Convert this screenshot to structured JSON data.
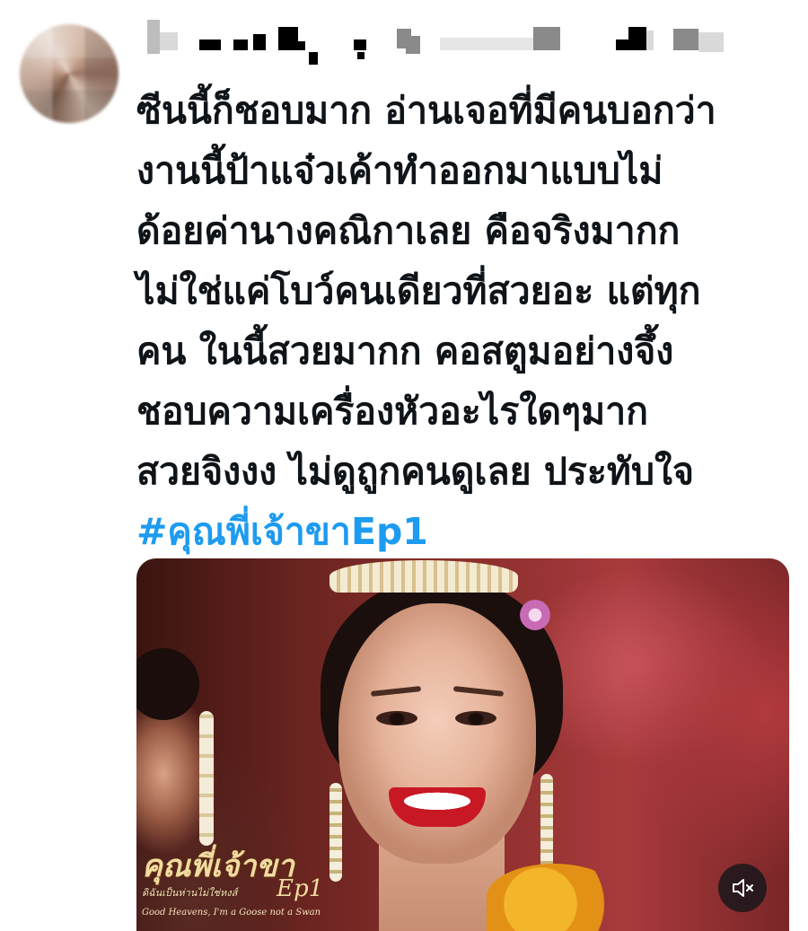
{
  "tweet": {
    "lines": [
      "ซีนนี้ก็ชอบมาก อ่านเจอที่มีคนบอกว่า",
      "งานนี้ป้าแจ๋วเค้าทำออกมาแบบไม่",
      "ด้อยค่านางคณิกาเลย คือจริงมากก",
      "ไม่ใช่แค่โบว์คนเดียวที่สวยอะ แต่ทุก",
      "คน ในนี้สวยมากก คอสตูมอย่างจึ้ง",
      "ชอบความเครื่องหัวอะไรใดๆมาก",
      "สวยจิงงง ไม่ดูถูกคนดูเลย ประทับใจ"
    ],
    "hashtag": "#คุณพี่เจ้าขาEp1",
    "hashtag_color": "#1d9bf0",
    "text_color": "#0f1419"
  },
  "media": {
    "logo_title": "คุณพี่เจ้าขา",
    "logo_subtitle": "ดิฉันเป็นห่านไม่ใช่หงส์",
    "logo_english": "Good Heavens, I'm a Goose not a Swan",
    "logo_episode": "Ep1",
    "mute_icon": "speaker-muted-icon"
  }
}
